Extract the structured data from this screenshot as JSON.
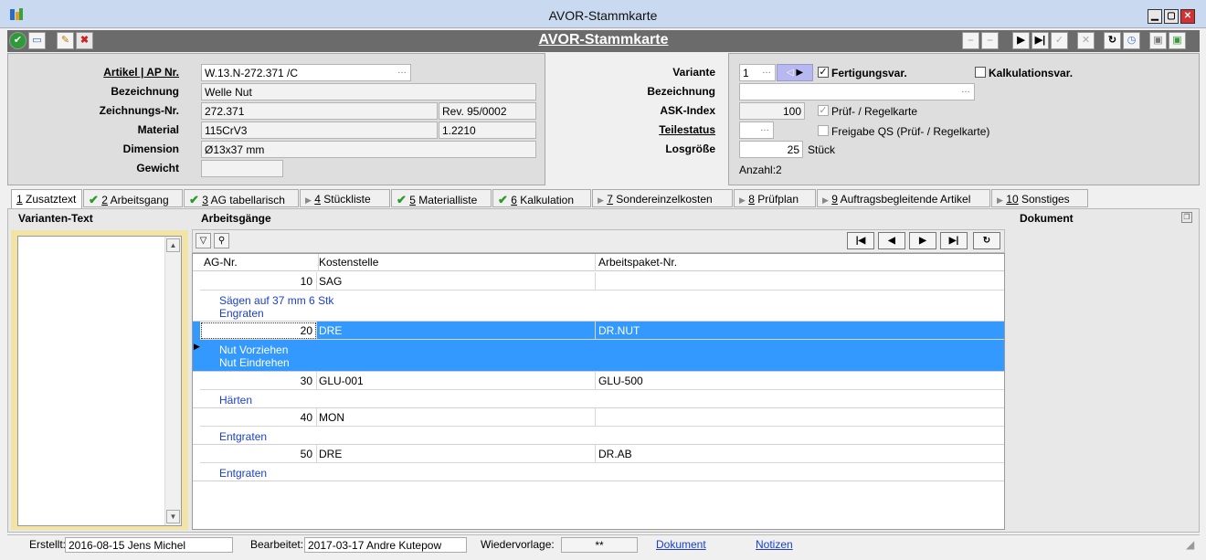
{
  "window": {
    "title": "AVOR-Stammkarte"
  },
  "toolbar": {
    "title": "AVOR-Stammkarte"
  },
  "header": {
    "artikel": {
      "label": "Artikel | AP Nr.",
      "value": "W.13.N-272.371 /C"
    },
    "bezeichnung": {
      "label": "Bezeichnung",
      "value": "Welle Nut"
    },
    "zeichnung": {
      "label": "Zeichnungs-Nr.",
      "value": "272.371",
      "rev": "Rev. 95/0002"
    },
    "material": {
      "label": "Material",
      "value": "115CrV3",
      "code": "1.2210"
    },
    "dimension": {
      "label": "Dimension",
      "value": "Ø13x37 mm"
    },
    "gewicht": {
      "label": "Gewicht",
      "value": ""
    },
    "variante": {
      "label": "Variante",
      "value": "1"
    },
    "fertigungsvar": {
      "label": "Fertigungsvar.",
      "checked": true
    },
    "kalkulationsvar": {
      "label": "Kalkulationsvar.",
      "checked": false
    },
    "bezeichnung2": {
      "label": "Bezeichnung",
      "value": ""
    },
    "ask": {
      "label": "ASK-Index",
      "value": "100"
    },
    "pruef": {
      "label": "Prüf- / Regelkarte",
      "checked": true
    },
    "teilestatus": {
      "label": "Teilestatus",
      "value": ""
    },
    "freigabe": {
      "label": "Freigabe QS (Prüf- / Regelkarte)",
      "checked": false
    },
    "losgroesse": {
      "label": "Losgröße",
      "value": "25",
      "unit": "Stück"
    },
    "anzahl": "Anzahl:2"
  },
  "tabs": [
    {
      "num": "1",
      "label": "Zusatztext",
      "status": "active"
    },
    {
      "num": "2",
      "label": "Arbeitsgang",
      "status": "check"
    },
    {
      "num": "3",
      "label": "AG tabellarisch",
      "status": "check"
    },
    {
      "num": "4",
      "label": "Stückliste",
      "status": "arrow"
    },
    {
      "num": "5",
      "label": "Materialliste",
      "status": "check"
    },
    {
      "num": "6",
      "label": "Kalkulation",
      "status": "check"
    },
    {
      "num": "7",
      "label": "Sondereinzelkosten",
      "status": "arrow"
    },
    {
      "num": "8",
      "label": "Prüfplan",
      "status": "arrow"
    },
    {
      "num": "9",
      "label": "Auftragsbegleitende Artikel",
      "status": "arrow"
    },
    {
      "num": "10",
      "label": "Sonstiges",
      "status": "arrow"
    }
  ],
  "sections": {
    "left": "Varianten-Text",
    "middle": "Arbeitsgänge",
    "right": "Dokument"
  },
  "grid": {
    "columns": [
      "AG-Nr.",
      "Kostenstelle",
      "Arbeitspaket-Nr."
    ],
    "rows": [
      {
        "ag": "10",
        "ks": "SAG",
        "ap": "",
        "desc": [
          "Sägen auf 37 mm  6 Stk",
          "Engraten"
        ],
        "selected": false
      },
      {
        "ag": "20",
        "ks": "DRE",
        "ap": "DR.NUT",
        "desc": [
          "Nut Vorziehen",
          "Nut Eindrehen"
        ],
        "selected": true
      },
      {
        "ag": "30",
        "ks": "GLU-001",
        "ap": "GLU-500",
        "desc": [
          "Härten"
        ],
        "selected": false
      },
      {
        "ag": "40",
        "ks": "MON",
        "ap": "",
        "desc": [
          "Entgraten"
        ],
        "selected": false
      },
      {
        "ag": "50",
        "ks": "DRE",
        "ap": "DR.AB",
        "desc": [
          "Entgraten"
        ],
        "selected": false
      }
    ]
  },
  "status": {
    "erstellt_label": "Erstellt:",
    "erstellt_value": "2016-08-15  Jens Michel",
    "bearbeitet_label": "Bearbeitet:",
    "bearbeitet_value": "2017-03-17  Andre Kutepow",
    "wiedervorlage_label": "Wiedervorlage:",
    "wiedervorlage_value": "**",
    "dokument_link": "Dokument",
    "notizen_link": "Notizen"
  },
  "colors": {
    "selection": "#3399ff",
    "link": "#1a3fcf",
    "toolbar": "#6b6b6b",
    "titlebar": "#c9d9ef"
  }
}
